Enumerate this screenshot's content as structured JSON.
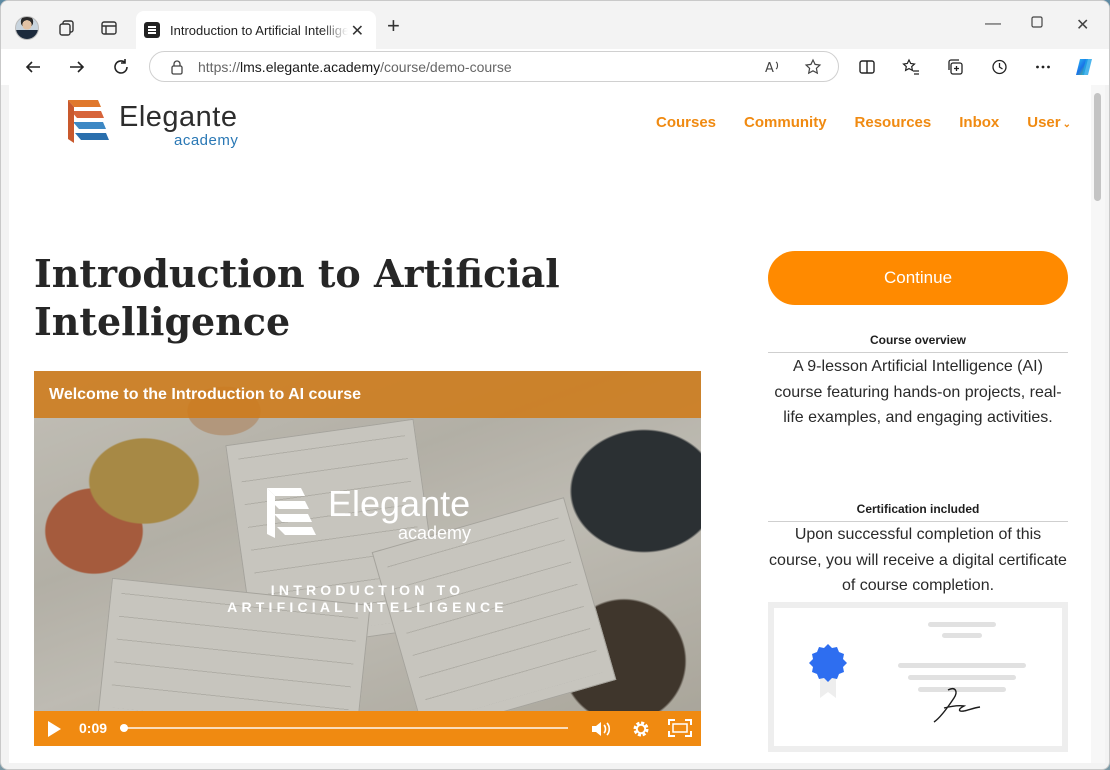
{
  "browser": {
    "tab_title": "Introduction to Artificial Intelligence",
    "url_scheme": "https://",
    "url_host": "lms.elegante.academy",
    "url_path": "/course/demo-course"
  },
  "site": {
    "logo_word": "Elegante",
    "logo_sub": "academy",
    "nav": [
      "Courses",
      "Community",
      "Resources",
      "Inbox",
      "User"
    ]
  },
  "course": {
    "title": "Introduction to Artificial Intelligence"
  },
  "video": {
    "header": "Welcome to the Introduction to AI course",
    "logo_word": "Elegante",
    "logo_sub": "academy",
    "title_line1": "INTRODUCTION TO",
    "title_line2": "ARTIFICIAL INTELLIGENCE",
    "time": "0:09",
    "progress": 0.01
  },
  "sidebar": {
    "continue_label": "Continue",
    "overview_heading": "Course overview",
    "overview_text": "A 9-lesson Artificial Intelligence (AI) course featuring hands-on projects, real-life examples, and engaging activities.",
    "cert_heading": "Certification included",
    "cert_text": "Upon successful completion of this course, you will receive a digital certificate of course completion."
  },
  "colors": {
    "accent": "#f08a11",
    "button": "#ff8a00",
    "logo_blue": "#2a78b5",
    "badge_blue": "#2e6ef0"
  }
}
